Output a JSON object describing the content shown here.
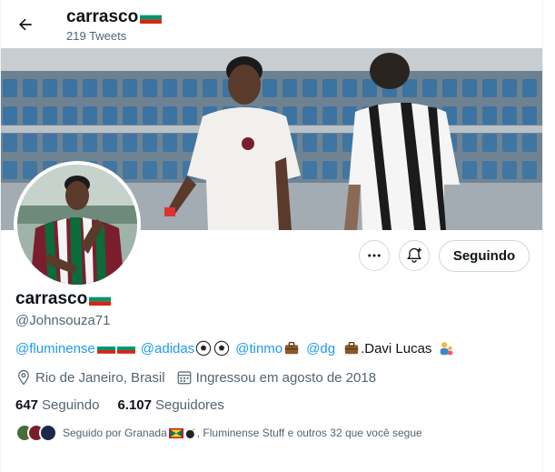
{
  "header": {
    "name": "carrasco",
    "tweet_count": "219 Tweets"
  },
  "profile": {
    "name": "carrasco",
    "handle": "@Johnsouza71",
    "follow_button": "Seguindo",
    "bio": {
      "mention1": "@fluminense",
      "mention2": "@adidas",
      "mention3": "@tinmo",
      "mention4": "@dg",
      "text_end": ".Davi Lucas"
    },
    "location": "Rio de Janeiro, Brasil",
    "joined": "Ingressou em agosto de 2018",
    "following_count": "647",
    "following_label": "Seguindo",
    "followers_count": "6.107",
    "followers_label": "Seguidores",
    "followed_by_prefix": "Seguido por Granada",
    "followed_by_suffix": ", Fluminense Stuff e outros 32 que você segue"
  },
  "icons": [
    "back-arrow-icon",
    "more-icon",
    "bell-add-icon",
    "location-icon",
    "calendar-icon"
  ],
  "colors": {
    "accent": "#1d9bf0",
    "muted": "#536471",
    "text": "#0f1419",
    "fluminense_maroon": "#7a1e2e",
    "fluminense_green": "#0b6b3a"
  }
}
